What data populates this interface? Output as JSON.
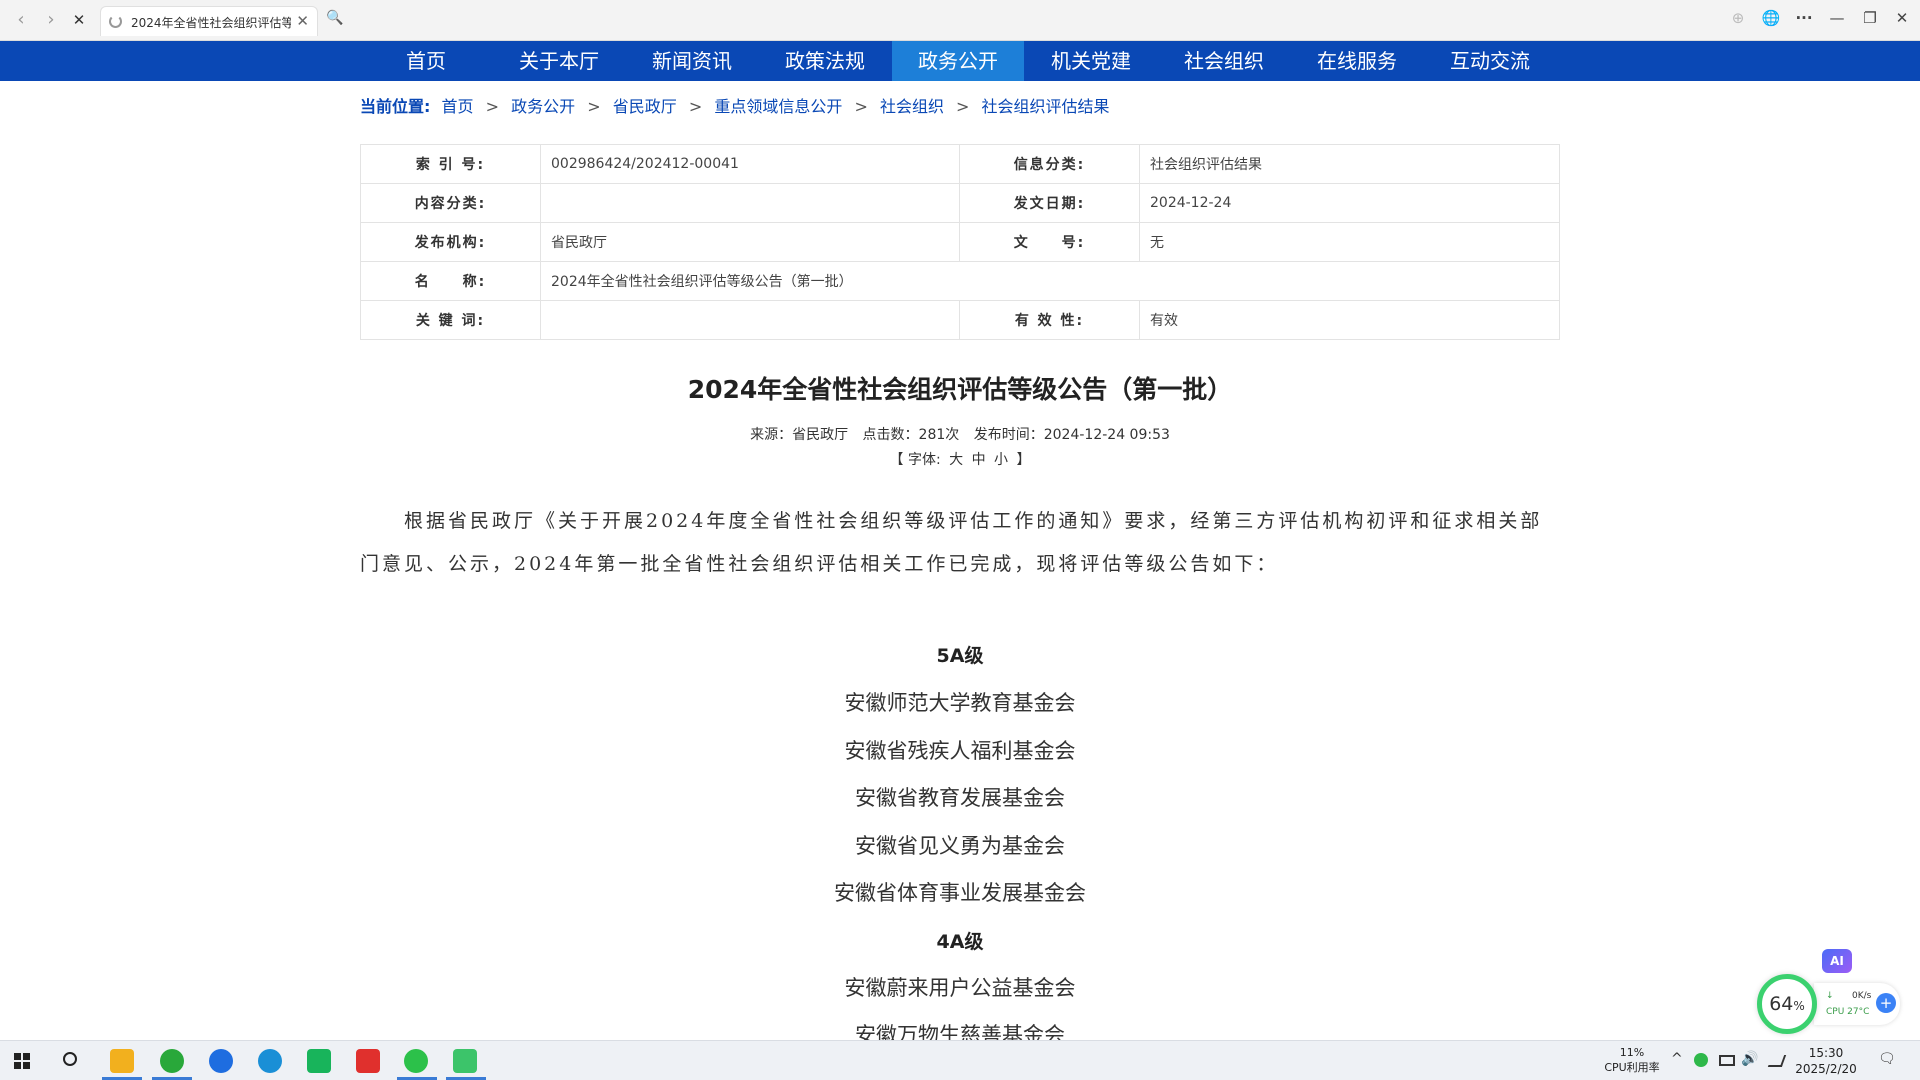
{
  "browser": {
    "tab_title": "2024年全省性社会组织评估等",
    "back_icon": "‹",
    "forward_icon": "›",
    "stop_icon": "✕",
    "close_icon": "✕",
    "search_icon": "🔍",
    "download_icon": "⊕",
    "globe_icon": "🌐",
    "more_icon": "···",
    "minimize_icon": "—",
    "restore_icon": "❐",
    "window_close_icon": "✕"
  },
  "nav": {
    "items": [
      {
        "label": "首页"
      },
      {
        "label": "关于本厅"
      },
      {
        "label": "新闻资讯"
      },
      {
        "label": "政策法规"
      },
      {
        "label": "政务公开"
      },
      {
        "label": "机关党建"
      },
      {
        "label": "社会组织"
      },
      {
        "label": "在线服务"
      },
      {
        "label": "互动交流"
      }
    ],
    "active_index": 4,
    "bg_color": "#0a48b5",
    "active_color": "#1d7fd8"
  },
  "breadcrumb": {
    "label": "当前位置:",
    "items": [
      "首页",
      "政务公开",
      "省民政厅",
      "重点领域信息公开",
      "社会组织",
      "社会组织评估结果"
    ],
    "separator": ">"
  },
  "meta": {
    "index_label": "索 引 号:",
    "index_value": "002986424/202412-00041",
    "info_cat_label": "信息分类:",
    "info_cat_value": "社会组织评估结果",
    "content_cat_label": "内容分类:",
    "content_cat_value": "",
    "date_label": "发文日期:",
    "date_value": "2024-12-24",
    "org_label": "发布机构:",
    "org_value": "省民政厅",
    "doc_no_label": "文　　号:",
    "doc_no_value": "无",
    "name_label": "名　　称:",
    "name_value": "2024年全省性社会组织评估等级公告（第一批）",
    "keywords_label": "关 键 词:",
    "keywords_value": "",
    "validity_label": "有 效 性:",
    "validity_value": "有效"
  },
  "article": {
    "title": "2024年全省性社会组织评估等级公告（第一批）",
    "source": "来源：省民政厅",
    "clicks": "点击数：281次",
    "published": "发布时间：2024-12-24 09:53",
    "font_bar_open": "【 字体:",
    "font_large": "大",
    "font_medium": "中",
    "font_small": "小",
    "font_bar_close": "】",
    "body": "根据省民政厅《关于开展2024年度全省性社会组织等级评估工作的通知》要求，经第三方评估机构初评和征求相关部门意见、公示，2024年第一批全省性社会组织评估相关工作已完成，现将评估等级公告如下：",
    "grade_5a": "5A级",
    "list_5a": [
      "安徽师范大学教育基金会",
      "安徽省残疾人福利基金会",
      "安徽省教育发展基金会",
      "安徽省见义勇为基金会",
      "安徽省体育事业发展基金会"
    ],
    "grade_4a": "4A级",
    "list_4a": [
      "安徽蔚来用户公益基金会",
      "安徽万物生慈善基金会"
    ]
  },
  "widget": {
    "ai_label": "AI",
    "gauge_value": "64",
    "gauge_unit": "%",
    "net_arrow": "↓",
    "net_speed": "0K/s",
    "cpu_temp": "CPU 27°C",
    "plus": "+"
  },
  "taskbar": {
    "cpu_value": "11%",
    "cpu_label": "CPU利用率",
    "time": "15:30",
    "date": "2025/2/20",
    "tray_chevron": "^",
    "speaker_icon": "🔊",
    "notification_icon": "🗨"
  }
}
